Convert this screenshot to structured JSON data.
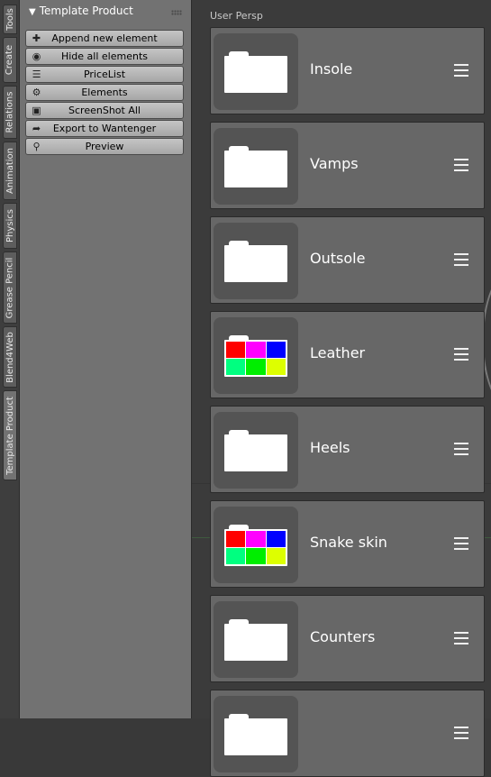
{
  "tabs": [
    {
      "label": "Tools",
      "active": false
    },
    {
      "label": "Create",
      "active": false
    },
    {
      "label": "Relations",
      "active": false
    },
    {
      "label": "Animation",
      "active": false
    },
    {
      "label": "Physics",
      "active": false
    },
    {
      "label": "Grease Pencil",
      "active": false
    },
    {
      "label": "Blend4Web",
      "active": false
    },
    {
      "label": "Template Product",
      "active": true
    }
  ],
  "panel": {
    "title": "Template Product",
    "collapse_glyph": "▼",
    "buttons": [
      {
        "label": "Append new element",
        "icon": "append-icon"
      },
      {
        "label": "Hide all elements",
        "icon": "eye-icon"
      },
      {
        "label": "PriceList",
        "icon": "list-icon"
      },
      {
        "label": "Elements",
        "icon": "nodes-icon"
      },
      {
        "label": "ScreenShot All",
        "icon": "camera-icon"
      },
      {
        "label": "Export to Wantenger",
        "icon": "export-icon"
      },
      {
        "label": "Preview",
        "icon": "preview-icon"
      }
    ]
  },
  "viewport": {
    "label": "User Persp"
  },
  "elements": [
    {
      "name": "Insole",
      "thumbnail": "folder"
    },
    {
      "name": "Vamps",
      "thumbnail": "folder"
    },
    {
      "name": "Outsole",
      "thumbnail": "folder"
    },
    {
      "name": "Leather",
      "thumbnail": "swatches"
    },
    {
      "name": "Heels",
      "thumbnail": "folder"
    },
    {
      "name": "Snake skin",
      "thumbnail": "swatches"
    },
    {
      "name": "Counters",
      "thumbnail": "folder"
    },
    {
      "name": "",
      "thumbnail": "folder"
    }
  ],
  "swatch_colors": [
    "#ff0000",
    "#ff00ff",
    "#0000ff",
    "#00ff80",
    "#00ee00",
    "#ddff00"
  ],
  "colors": {
    "panel_bg": "#727272",
    "card_bg": "#676767",
    "thumb_bg": "#545454",
    "button_bg": "#b5b5b5"
  }
}
